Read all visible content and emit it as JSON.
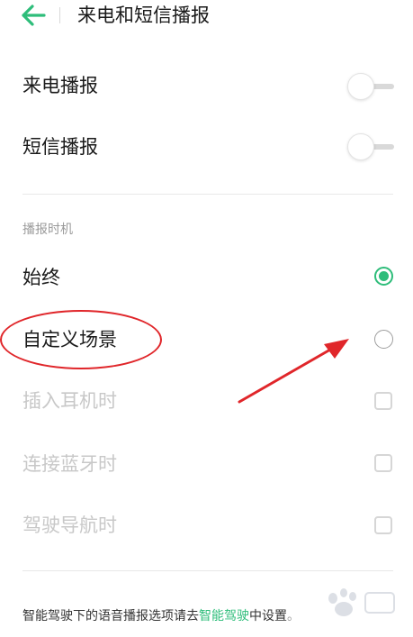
{
  "header": {
    "title": "来电和短信播报",
    "back_icon": "back-arrow-icon",
    "accent_color": "#2ebd7a"
  },
  "toggles": [
    {
      "label": "来电播报",
      "on": false
    },
    {
      "label": "短信播报",
      "on": false
    }
  ],
  "section": {
    "label": "播报时机",
    "radios": [
      {
        "label": "始终",
        "checked": true
      },
      {
        "label": "自定义场景",
        "checked": false
      }
    ],
    "scenes": [
      {
        "label": "插入耳机时",
        "checked": false,
        "enabled": false
      },
      {
        "label": "连接蓝牙时",
        "checked": false,
        "enabled": false
      },
      {
        "label": "驾驶导航时",
        "checked": false,
        "enabled": false
      }
    ]
  },
  "footer": {
    "prefix": "智能驾驶下的语音播报选项请去",
    "link": "智能驾驶",
    "suffix_main": "中设置",
    "suffix_end": "。"
  },
  "annotations": {
    "highlight_color": "#e0262a"
  }
}
